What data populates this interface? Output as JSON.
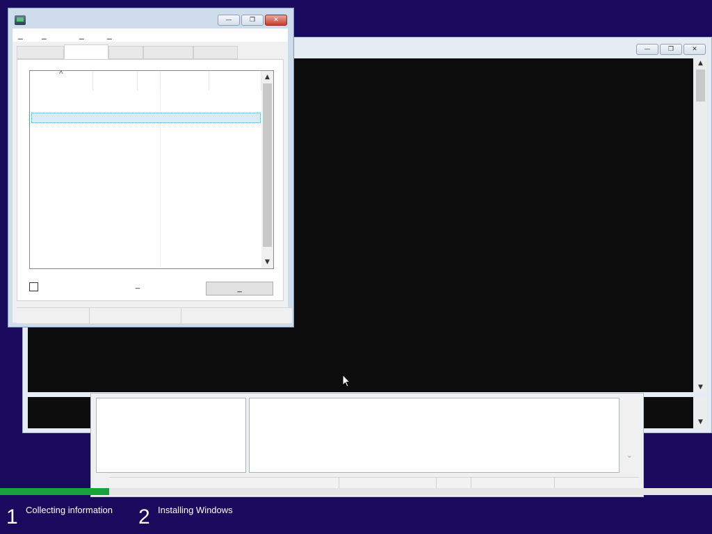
{
  "console_window": {
    "minimize_glyph": "—",
    "restore_glyph": "❐",
    "close_glyph": "✕",
    "scroll_up_glyph": "▲",
    "scroll_down_glyph": "▼"
  },
  "task_manager": {
    "minimize_glyph": "—",
    "restore_glyph": "❐",
    "close_glyph": "✕",
    "menu": [
      "_",
      "_",
      "_",
      "_"
    ],
    "tabs": [
      "",
      "",
      "",
      "",
      ""
    ],
    "active_tab_index": 1,
    "columns": [
      "",
      "",
      "",
      "",
      ""
    ],
    "sort_indicator": "^",
    "selected_row_text": "",
    "checkbox_label": "",
    "middle_text": "_",
    "end_button_label": "_"
  },
  "progress": {
    "fraction": 0.153,
    "fill_color": "#1aa33c"
  },
  "steps": [
    {
      "number": "1",
      "label": "Collecting information"
    },
    {
      "number": "2",
      "label": "Installing Windows"
    }
  ],
  "colors": {
    "desktop_bg": "#1a0a5e",
    "console_bg": "#0c0c0c",
    "selection_bg": "#d9ebf9"
  }
}
